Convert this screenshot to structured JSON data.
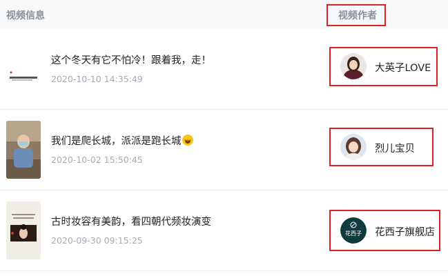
{
  "header": {
    "video_info_label": "视频信息",
    "video_author_label": "视频作者"
  },
  "rows": [
    {
      "title": "这个冬天有它不怕冷！跟着我，走！",
      "time": "2020-10-10 14:35:49",
      "author": "大英子LOVE",
      "has_emoji": false
    },
    {
      "title": "我们是爬长城，派派是跑长城",
      "time": "2020-10-02 15:50:45",
      "author": "烈儿宝贝",
      "has_emoji": true
    },
    {
      "title": "古时妆容有美韵，看四朝代频妆演变",
      "time": "2020-09-30 09:15:25",
      "author": "花西子旗舰店",
      "has_emoji": false
    }
  ],
  "colors": {
    "highlight_border": "#e02020",
    "header_bg": "#f7f8fa",
    "muted_text": "#a6abb5"
  }
}
